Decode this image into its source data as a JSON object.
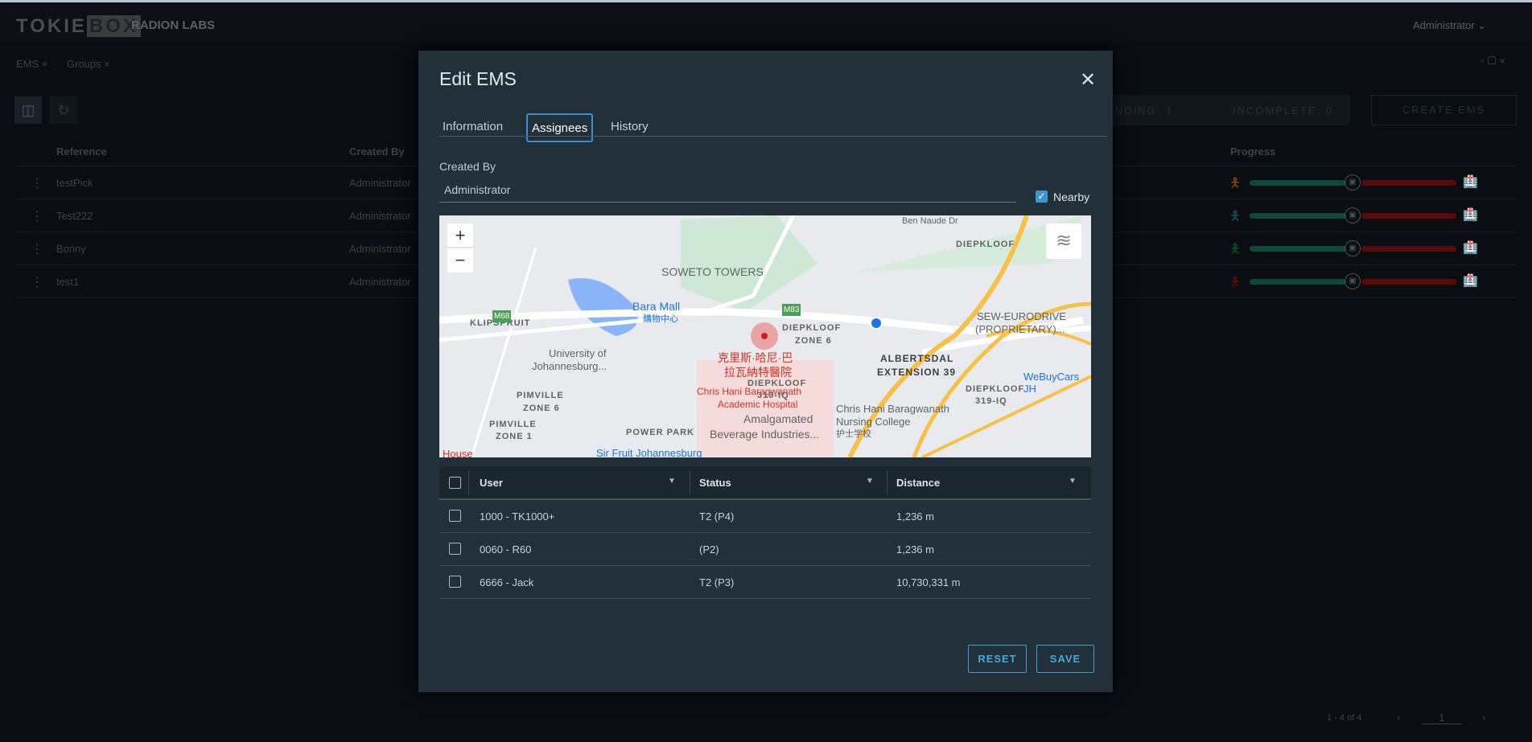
{
  "app": {
    "logo": "TOKIEBOX",
    "org": "RADION LABS",
    "user": "Administrator"
  },
  "tabs": [
    {
      "label": "EMS"
    },
    {
      "label": "Groups"
    }
  ],
  "toolbar": {
    "pending": "NDING: 1",
    "incomplete": "INCOMPLETE: 0",
    "create": "CREATE EMS"
  },
  "list": {
    "headers": {
      "reference": "Reference",
      "created_by": "Created By",
      "progress": "Progress"
    },
    "rows": [
      {
        "reference": "testPick",
        "created_by": "Administrator",
        "person_color": "#8a4a12"
      },
      {
        "reference": "Test222",
        "created_by": "Administrator",
        "person_color": "#1f4e66"
      },
      {
        "reference": "Bonny",
        "created_by": "Administrator",
        "person_color": "#13521f"
      },
      {
        "reference": "test1",
        "created_by": "Administrator",
        "person_color": "#6a0a0a"
      }
    ]
  },
  "pagination": {
    "summary": "1 - 4 of 4",
    "page": "1"
  },
  "modal": {
    "title": "Edit EMS",
    "tabs": [
      {
        "label": "Information"
      },
      {
        "label": "Assignees",
        "active": true
      },
      {
        "label": "History"
      }
    ],
    "created_by_label": "Created By",
    "created_by_value": "Administrator",
    "nearby_label": "Nearby",
    "nearby_checked": true,
    "map": {
      "labels": {
        "soweto": "SOWETO TOWERS",
        "bara": "Bara Mall",
        "bara_cn": "購物中心",
        "klip": "KLIPSPRUIT",
        "uj1": "University of",
        "uj2": "Johannesburg...",
        "diep6a": "DIEPKLOOF",
        "diep6b": "ZONE 6",
        "hosp_cn1": "克里斯·哈尼·巴",
        "hosp_cn2": "拉瓦納特醫院",
        "hosp1": "Chris Hani Baragwanath",
        "hosp2": "Academic Hospital",
        "alb1": "ALBERTSDAL",
        "alb2": "EXTENSION 39",
        "sew1": "SEW-EURODRIVE",
        "sew2": "(PROPRIETARY)...",
        "webuy": "WeBuyCars JH",
        "nurs1": "Chris Hani Baragwanath",
        "nurs2": "Nursing College",
        "nurs3": "护士学校",
        "pim1a": "PIMVILLE",
        "pim1b": "ZONE 1",
        "power": "POWER PARK",
        "diep319a": "DIEPKLOOF",
        "diep319b": "319-IQ",
        "diep319c": "DIEPKLOOF",
        "diep319d": "319-IQ",
        "pim6a": "PIMVILLE",
        "pim6b": "ZONE 6",
        "amal1": "Amalgamated",
        "amal2": "Beverage Industries...",
        "sir": "Sir Fruit Johannesburg",
        "house": "House",
        "diepn": "DIEPKLOOF",
        "m68": "M68",
        "m83": "M83",
        "ben": "Ben Naude Dr",
        "zoom_in": "+",
        "zoom_out": "−"
      }
    },
    "table": {
      "headers": {
        "user": "User",
        "status": "Status",
        "distance": "Distance"
      },
      "rows": [
        {
          "user": "1000 - TK1000+",
          "status": "T2 (P4)",
          "distance": "1,236 m"
        },
        {
          "user": "0060 - R60",
          "status": "(P2)",
          "distance": "1,236 m"
        },
        {
          "user": "6666 - Jack",
          "status": "T2 (P3)",
          "distance": "10,730,331 m"
        }
      ]
    },
    "reset": "RESET",
    "save": "SAVE"
  },
  "colors": {
    "accent": "#3b9ed0",
    "progress_done": "#0d4a35",
    "progress_todo": "#5a0a0a"
  }
}
